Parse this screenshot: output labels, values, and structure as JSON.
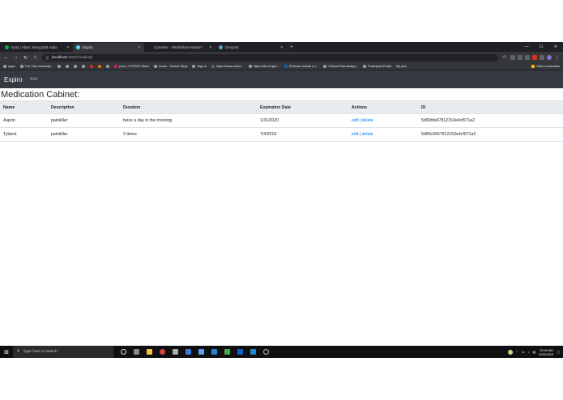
{
  "browser": {
    "tabs": [
      {
        "title": "Data | Atlas: MongoDB Atlas",
        "favicon_color": "#13aa52",
        "active": false
      },
      {
        "title": "Expiro",
        "favicon_color": "#61dafb",
        "active": true
      },
      {
        "title": "Commits · nRehkhan/HackNY",
        "favicon_color": "#1b1f23",
        "active": false
      },
      {
        "title": "Devpost",
        "favicon_color": "#5fa6d2",
        "active": false
      }
    ],
    "new_tab_icon": "+",
    "url_host": "localhost",
    "url_path": ":3000/medicab",
    "bookmarks": [
      "Apps",
      "The City University...",
      "jobs | CTP2019 Slack",
      "Doors - Texture Ninja",
      "Sign in",
      "https://www.online...",
      "https://bfa.ed.gov...",
      "Rehman Arshad | Li...",
      "Clinical Data Analys...",
      "Participant Portal",
      "My jobs"
    ],
    "other_bookmarks": "Other bookmarks"
  },
  "app": {
    "brand": "Expiro",
    "nav_add": "Add",
    "page_title": "Medication Cabinet:",
    "table": {
      "headers": [
        "Name",
        "Description",
        "Duration",
        "Expiration Date",
        "Actions",
        "ID"
      ],
      "rows": [
        {
          "name": "Asprin",
          "description": "painkiller",
          "duration": "twice a day in the morning",
          "expiration": "1/31/2020",
          "edit": "edit",
          "delete": "delete",
          "id": "5d90bfe67812153e4cf071a2"
        },
        {
          "name": "Tylanol",
          "description": "painkiller",
          "duration": "2 times",
          "expiration": "7/4/2018",
          "edit": "edit",
          "delete": "delete",
          "id": "5d90c0067812153e4cf071a3"
        }
      ],
      "separator": "|"
    },
    "link_color": "#007bff",
    "navbar_color": "#343a40"
  },
  "taskbar": {
    "search_placeholder": "Type here to search",
    "time": "10:45 AM",
    "date": "9/29/2019"
  }
}
